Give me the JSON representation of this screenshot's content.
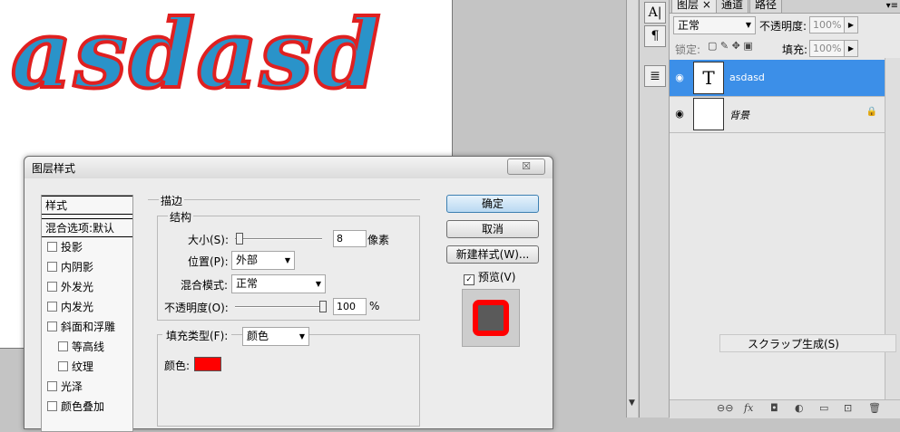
{
  "canvas": {
    "art_text": "asdasd",
    "text_fill_color": "#2a93c9",
    "text_stroke_color": "#e02020"
  },
  "tools": {
    "icons": [
      "character-icon",
      "paragraph-icon",
      "notes-icon"
    ],
    "glyphs": [
      "A|",
      "¶",
      "≣"
    ]
  },
  "layers_panel": {
    "tabs": [
      "图层",
      "通道",
      "路径"
    ],
    "tab_close": "×",
    "menu_glyph": "▾≡",
    "blend_mode": "正常",
    "opacity_label": "不透明度:",
    "opacity_value": "100%",
    "lock_label": "锁定:",
    "fill_label": "填充:",
    "fill_value": "100%",
    "layers": [
      {
        "name": "asdasd",
        "thumb": "T",
        "selected": true
      },
      {
        "name": "背景",
        "thumb": "",
        "locked": true
      }
    ],
    "footer_icons": [
      "link-icon",
      "fx-icon",
      "mask-icon",
      "adjustment-icon",
      "group-icon",
      "new-layer-icon",
      "trash-icon"
    ],
    "footer_glyphs": [
      "⊖⊖",
      "fx",
      "◘",
      "◐",
      "▭",
      "⊡",
      "🗑"
    ]
  },
  "tooltip": {
    "text": "スクラップ生成(S)"
  },
  "dialog": {
    "title": "图层样式",
    "close_glyph": "☒",
    "styles_header": "样式",
    "blend_options": "混合选项:默认",
    "style_items": [
      "投影",
      "内阴影",
      "外发光",
      "内发光",
      "斜面和浮雕",
      "等高线",
      "纹理",
      "光泽",
      "颜色叠加"
    ],
    "section_title": "描边",
    "structure_title": "结构",
    "size_label": "大小(S):",
    "size_value": "8",
    "size_unit": "像素",
    "size_fraction": 0.04,
    "position_label": "位置(P):",
    "position_value": "外部",
    "blend_label": "混合模式:",
    "blend_value": "正常",
    "opacity_label": "不透明度(O):",
    "opacity_value": "100",
    "opacity_unit": "%",
    "opacity_fraction": 1.0,
    "fill_type_label": "填充类型(F):",
    "fill_type_value": "颜色",
    "color_label": "颜色:",
    "stroke_color": "#ff0000",
    "ok_label": "确定",
    "cancel_label": "取消",
    "new_style_label": "新建样式(W)...",
    "preview_label": "预览(V)",
    "preview_checked": true
  }
}
